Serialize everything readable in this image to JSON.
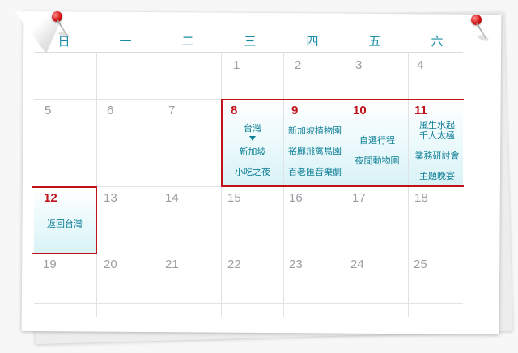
{
  "weekdays": [
    "日",
    "一",
    "二",
    "三",
    "四",
    "五",
    "六"
  ],
  "days": {
    "row1": [
      "",
      "",
      "",
      "1",
      "2",
      "3",
      "4"
    ],
    "row2": [
      "5",
      "6",
      "7",
      "8",
      "9",
      "10",
      "11"
    ],
    "row3": [
      "12",
      "13",
      "14",
      "15",
      "16",
      "17",
      "18"
    ],
    "row4": [
      "19",
      "20",
      "21",
      "22",
      "23",
      "24",
      "25"
    ]
  },
  "events": {
    "d8": {
      "line1": "台灣",
      "line2": "新加坡",
      "line3": "小吃之夜"
    },
    "d9": {
      "line1": "新加坡植物園",
      "line2": "裕廊飛禽鳥園",
      "line3": "百老匯音樂劇"
    },
    "d10": {
      "line1": "自選行程",
      "line2": "夜間動物園"
    },
    "d11": {
      "line1": "風生水起",
      "line2": "千人太極",
      "line3": "業務研討會",
      "line4": "主題晚宴"
    },
    "d12": {
      "line1": "返回台灣"
    }
  },
  "colors": {
    "accent": "#1a8ea6",
    "event_text": "#0e7e96",
    "highlight_border": "#c0121b",
    "day_number": "#9a9ea2"
  }
}
